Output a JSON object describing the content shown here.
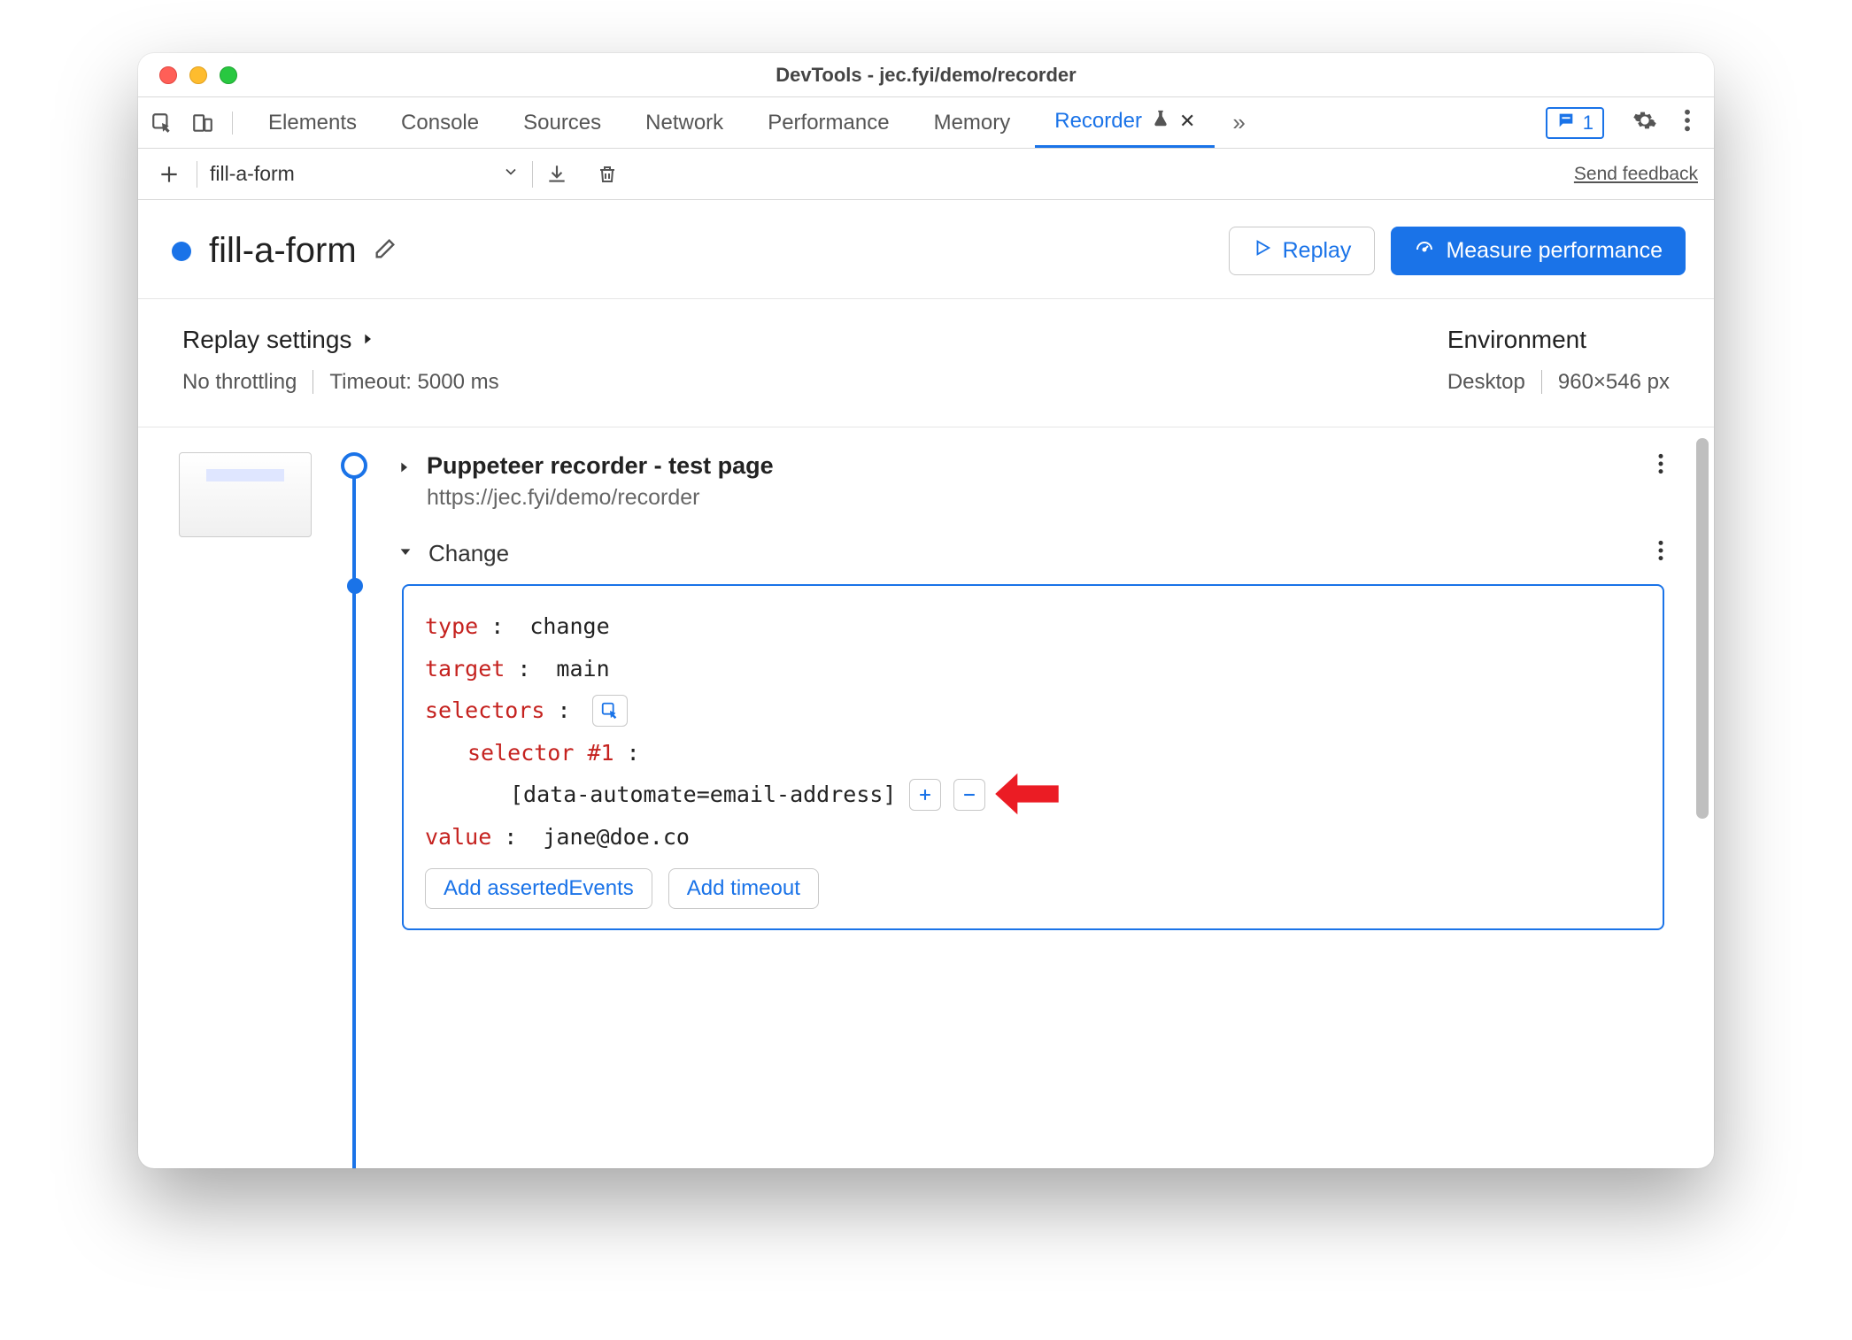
{
  "window": {
    "title": "DevTools - jec.fyi/demo/recorder"
  },
  "tabs": {
    "items": [
      "Elements",
      "Console",
      "Sources",
      "Network",
      "Performance",
      "Memory",
      "Recorder"
    ],
    "activeIndex": 6,
    "issuesCount": "1"
  },
  "toolbar": {
    "recordingName": "fill-a-form",
    "sendFeedback": "Send feedback"
  },
  "header": {
    "title": "fill-a-form",
    "replayLabel": "Replay",
    "measureLabel": "Measure performance"
  },
  "settings": {
    "replayHeading": "Replay settings",
    "throttling": "No throttling",
    "timeout": "Timeout: 5000 ms",
    "envHeading": "Environment",
    "device": "Desktop",
    "viewport": "960×546 px"
  },
  "steps": {
    "start": {
      "title": "Puppeteer recorder - test page",
      "url": "https://jec.fyi/demo/recorder"
    },
    "change": {
      "label": "Change",
      "fields": {
        "typeKey": "type",
        "typeVal": "change",
        "targetKey": "target",
        "targetVal": "main",
        "selectorsKey": "selectors",
        "selectorLabel": "selector #1",
        "selectorValue": "[data-automate=email-address]",
        "valueKey": "value",
        "valueVal": "jane@doe.co"
      },
      "actions": {
        "addAsserted": "Add assertedEvents",
        "addTimeout": "Add timeout"
      }
    }
  }
}
